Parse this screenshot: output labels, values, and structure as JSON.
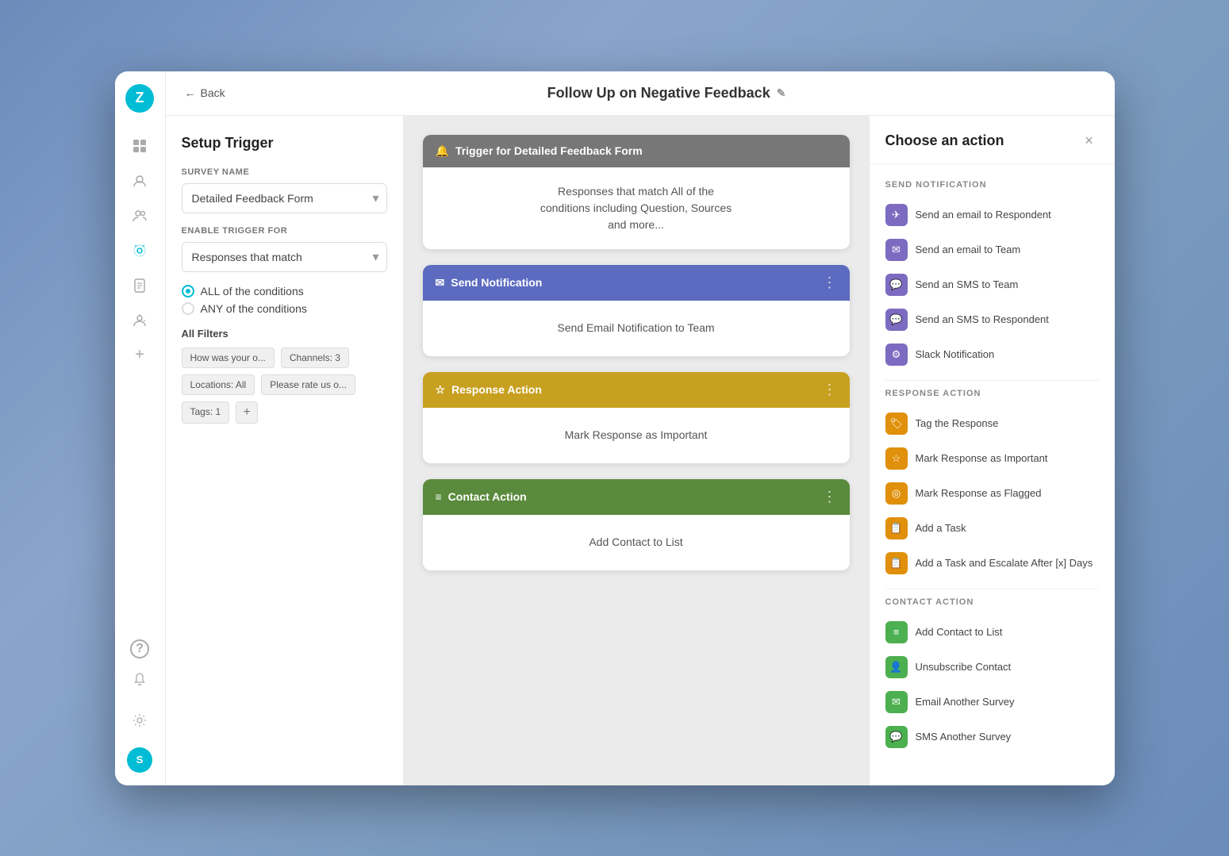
{
  "app": {
    "logo_letter": "Z",
    "title": "Follow Up on Negative Feedback",
    "back_label": "Back",
    "edit_icon": "✎"
  },
  "sidebar": {
    "nav_items": [
      {
        "id": "grid",
        "icon": "⊞",
        "active": false
      },
      {
        "id": "person",
        "icon": "◉",
        "active": false
      },
      {
        "id": "user",
        "icon": "👤",
        "active": false
      },
      {
        "id": "settings-gear",
        "icon": "⚙",
        "active": true
      },
      {
        "id": "document",
        "icon": "📄",
        "active": false
      },
      {
        "id": "user-plus",
        "icon": "👥",
        "active": false
      },
      {
        "id": "add",
        "icon": "+",
        "active": false
      }
    ],
    "bottom_items": [
      {
        "id": "help",
        "icon": "?"
      },
      {
        "id": "bell",
        "icon": "🔔"
      },
      {
        "id": "gear",
        "icon": "⚙"
      }
    ],
    "avatar_letter": "S"
  },
  "setup_trigger": {
    "title": "Setup Trigger",
    "survey_name_label": "SURVEY NAME",
    "survey_name_value": "Detailed Feedback Form",
    "enable_trigger_label": "ENABLE TRIGGER FOR",
    "enable_trigger_value": "Responses that match",
    "conditions": [
      {
        "id": "all",
        "label": "ALL of the conditions",
        "selected": true
      },
      {
        "id": "any",
        "label": "ANY of the conditions",
        "selected": false
      }
    ],
    "filters_label": "All Filters",
    "filter_tags": [
      "How was your o...",
      "Channels: 3",
      "Locations: All",
      "Please rate us o...",
      "Tags: 1"
    ],
    "add_filter_icon": "+"
  },
  "flow": {
    "cards": [
      {
        "id": "trigger",
        "type": "trigger",
        "header_icon": "🔔",
        "header_label": "Trigger for Detailed Feedback Form",
        "body_text": "Responses that match All of the conditions including Question, Sources and more..."
      },
      {
        "id": "send-notification",
        "type": "notify",
        "header_icon": "✉",
        "header_label": "Send Notification",
        "body_text": "Send Email Notification to Team"
      },
      {
        "id": "response-action",
        "type": "response",
        "header_icon": "☆",
        "header_label": "Response Action",
        "body_text": "Mark Response as Important"
      },
      {
        "id": "contact-action",
        "type": "contact",
        "header_icon": "≡",
        "header_label": "Contact Action",
        "body_text": "Add Contact to List"
      }
    ]
  },
  "choose_action": {
    "title": "Choose an action",
    "close_icon": "×",
    "sections": [
      {
        "id": "send-notification",
        "title": "SEND NOTIFICATION",
        "items": [
          {
            "id": "email-respondent",
            "icon": "✈",
            "icon_color": "icon-purple",
            "label": "Send an email to Respondent"
          },
          {
            "id": "email-team",
            "icon": "✉",
            "icon_color": "icon-purple",
            "label": "Send an email to Team"
          },
          {
            "id": "sms-team",
            "icon": "💬",
            "icon_color": "icon-purple",
            "label": "Send an SMS to Team"
          },
          {
            "id": "sms-respondent",
            "icon": "💬",
            "icon_color": "icon-purple",
            "label": "Send an SMS to Respondent"
          },
          {
            "id": "slack",
            "icon": "⚙",
            "icon_color": "icon-purple",
            "label": "Slack Notification"
          }
        ]
      },
      {
        "id": "response-action",
        "title": "RESPONSE ACTION",
        "items": [
          {
            "id": "tag-response",
            "icon": "🏷",
            "icon_color": "icon-orange",
            "label": "Tag the Response"
          },
          {
            "id": "mark-important",
            "icon": "☆",
            "icon_color": "icon-orange",
            "label": "Mark Response as Important"
          },
          {
            "id": "mark-flagged",
            "icon": "◎",
            "icon_color": "icon-orange",
            "label": "Mark Response as Flagged"
          },
          {
            "id": "add-task",
            "icon": "📋",
            "icon_color": "icon-orange",
            "label": "Add a Task"
          },
          {
            "id": "add-task-escalate",
            "icon": "📋",
            "icon_color": "icon-orange",
            "label": "Add a Task and Escalate After [x] Days"
          }
        ]
      },
      {
        "id": "contact-action",
        "title": "CONTACT ACTION",
        "items": [
          {
            "id": "add-contact",
            "icon": "≡",
            "icon_color": "icon-green",
            "label": "Add Contact to List"
          },
          {
            "id": "unsubscribe",
            "icon": "👤",
            "icon_color": "icon-green",
            "label": "Unsubscribe Contact"
          },
          {
            "id": "email-survey",
            "icon": "✉",
            "icon_color": "icon-green",
            "label": "Email Another Survey"
          },
          {
            "id": "sms-survey",
            "icon": "💬",
            "icon_color": "icon-green",
            "label": "SMS Another Survey"
          }
        ]
      }
    ]
  }
}
